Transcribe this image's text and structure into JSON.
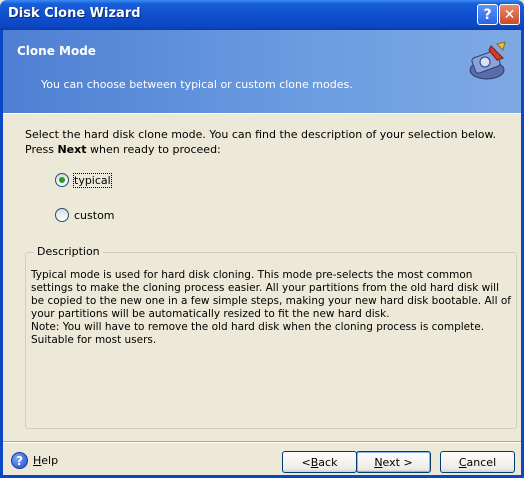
{
  "window": {
    "title": "Disk Clone Wizard",
    "help_glyph": "?",
    "close_glyph": "✕"
  },
  "header": {
    "title": "Clone Mode",
    "subtitle": "You can choose between typical or custom clone modes.",
    "logo_icon": "disk-clone-wizard-icon"
  },
  "content": {
    "intro_prefix": "Select the hard disk clone mode. You can find the description of your selection below. Press ",
    "intro_bold": "Next",
    "intro_suffix": " when ready to proceed:",
    "options": [
      {
        "label": "typical",
        "selected": true
      },
      {
        "label": "custom",
        "selected": false
      }
    ],
    "description": {
      "legend": "Description",
      "text_1": "Typical mode is used for hard disk cloning. This mode pre-selects the most common settings to make the cloning process easier. All your partitions from the old hard disk will be copied to the new one in a few simple steps, making your new hard disk bootable. All of your partitions will be automatically resized to fit the new hard disk.",
      "text_2": "Note: You will have to remove the old hard disk when the cloning process is complete.",
      "text_3": "Suitable for most users."
    }
  },
  "footer": {
    "help_label_u": "H",
    "help_label_rest": "elp",
    "back": {
      "prefix": "< ",
      "u": "B",
      "rest": "ack"
    },
    "next": {
      "u": "N",
      "rest": "ext >"
    },
    "cancel": {
      "u": "C",
      "rest": "ancel"
    }
  }
}
